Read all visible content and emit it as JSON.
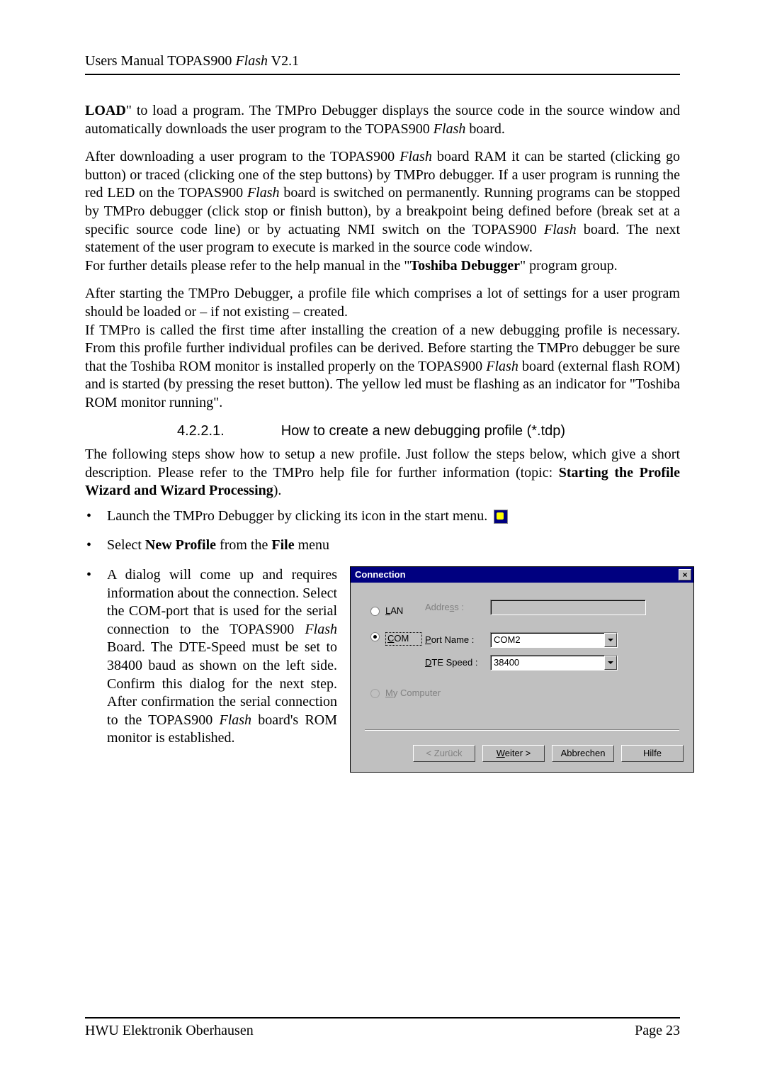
{
  "header": {
    "prefix": "Users Manual TOPAS900 ",
    "italic": "Flash",
    "suffix": " V2.1"
  },
  "p1": {
    "t1": "LOAD",
    "t2": "\" to load a program. The TMPro Debugger displays the source code in the source window and automatically downloads the user program to the TOPAS900 ",
    "i1": "Flash",
    "t3": " board."
  },
  "p2": {
    "t1": "After downloading a user program to the TOPAS900 ",
    "i1": "Flash",
    "t2": " board RAM it can be started (clicking go button) or traced (clicking one of the step buttons) by TMPro debugger. If a user program is running the red LED on the TOPAS900 ",
    "i2": "Flash",
    "t3": " board is switched on permanently. Running programs can be stopped by TMPro debugger (click stop or finish button), by a breakpoint being defined before (break set at a specific source code line) or by actuating NMI switch on the TOPAS900 ",
    "i3": "Flash",
    "t4": " board. The next statement of the user program to execute is marked in the source code window."
  },
  "p2b": {
    "t1": "For further details please refer to the help manual in the \"",
    "b1": "Toshiba Debugger",
    "t2": "\" program group."
  },
  "p3": "After starting the TMPro Debugger, a profile file which comprises a lot of settings for a user program should be loaded or – if not existing – created.",
  "p4": {
    "t1": "If TMPro is called the first time after installing the creation of a new debugging profile is necessary. From this profile further individual profiles can be derived. Before starting the TMPro debugger be sure that the Toshiba ROM monitor is installed properly on the TOPAS900 ",
    "i1": "Flash",
    "t2": " board (external flash ROM) and is started (by pressing the reset button). The yellow led must be flashing as an indicator for \"Toshiba ROM monitor running\"."
  },
  "section": {
    "num": "4.2.2.1.",
    "title": "How to create a new debugging profile (*.tdp)"
  },
  "p5": {
    "t1": "The following steps show how to setup a new profile. Just follow the steps below, which give a short description. Please refer to the TMPro help file for further information (topic: ",
    "b1": "Starting the Profile Wizard and Wizard Processing",
    "t2": ")."
  },
  "bul1": "Launch the TMPro Debugger by clicking its icon in the start menu.",
  "bul2": {
    "t1": "Select ",
    "b1": "New Profile",
    "t2": " from the ",
    "b2": "File",
    "t3": " menu"
  },
  "bul3": {
    "t1": "A dialog will come up and requires information about the connection. Select the COM-port that is used for the serial connection to the TOPAS900 ",
    "i1": "Flash",
    "t2": " Board. The DTE-Speed must be set to 38400 baud as shown on the left side. Confirm this dialog for the next step. After confirmation the serial connection to the TOPAS900 ",
    "i2": "Flash",
    "t3": " board's ROM monitor is established."
  },
  "dialog": {
    "title": "Connection",
    "close": "×",
    "lan_label": "LAN",
    "addr_label": "Address :",
    "addr_label_ul": "s",
    "com_label": "COM",
    "port_label": "Port Name :",
    "port_ul": "P",
    "port_value": "COM2",
    "dte_label": "DTE Speed :",
    "dte_ul": "D",
    "dte_value": "38400",
    "myc_label": "My Computer",
    "myc_ul": "M",
    "btn_back": "< Zurück",
    "btn_next_ul": "W",
    "btn_next_rest": "eiter >",
    "btn_cancel": "Abbrechen",
    "btn_help": "Hilfe"
  },
  "footer": {
    "left": "HWU Elektronik Oberhausen",
    "right": "Page 23"
  }
}
